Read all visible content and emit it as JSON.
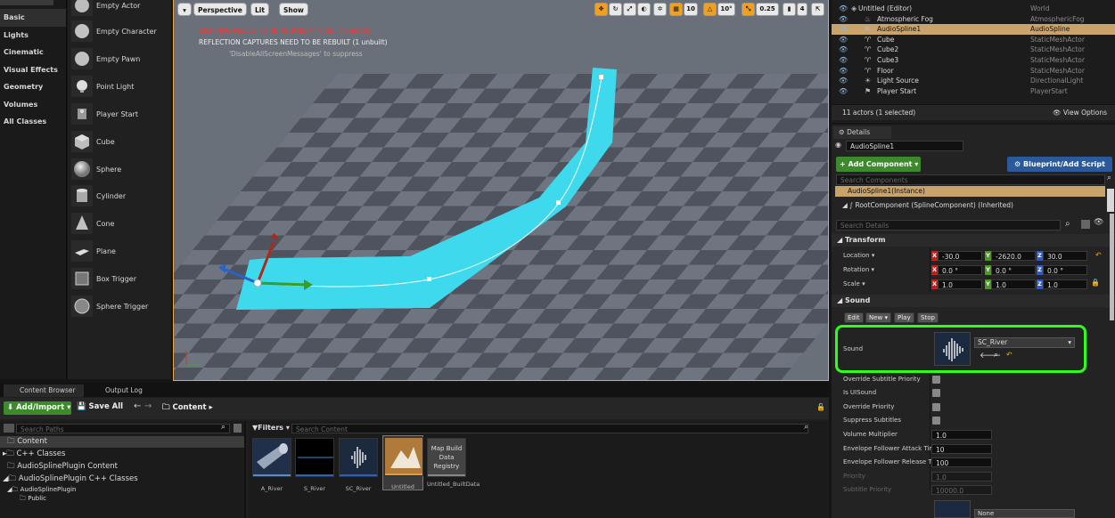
{
  "categories": [
    "Basic",
    "Lights",
    "Cinematic",
    "Visual Effects",
    "Geometry",
    "Volumes",
    "All Classes"
  ],
  "actors": [
    "Empty Actor",
    "Empty Character",
    "Empty Pawn",
    "Point Light",
    "Player Start",
    "Cube",
    "Sphere",
    "Cylinder",
    "Cone",
    "Plane",
    "Box Trigger",
    "Sphere Trigger"
  ],
  "viewport": {
    "perspective": "Perspective",
    "lit": "Lit",
    "show": "Show",
    "warning1": "LIGHTING NEEDS TO BE REBUILT (4 unbuilt objects)",
    "warning2": "REFLECTION CAPTURES NEED TO BE REBUILT (1 unbuilt)",
    "warning3": "'DisableAllScreenMessages' to suppress",
    "grid_snap": "10",
    "rot_snap": "10°",
    "scale_snap": "0.25",
    "cam_speed": "4"
  },
  "outliner": {
    "rows": [
      {
        "name": "Untitled (Editor)",
        "type": "World"
      },
      {
        "name": "Atmospheric Fog",
        "type": "AtmosphericFog"
      },
      {
        "name": "AudioSpline1",
        "type": "AudioSpline"
      },
      {
        "name": "Cube",
        "type": "StaticMeshActor"
      },
      {
        "name": "Cube2",
        "type": "StaticMeshActor"
      },
      {
        "name": "Cube3",
        "type": "StaticMeshActor"
      },
      {
        "name": "Floor",
        "type": "StaticMeshActor"
      },
      {
        "name": "Light Source",
        "type": "DirectionalLight"
      },
      {
        "name": "Player Start",
        "type": "PlayerStart"
      }
    ],
    "count": "11 actors (1 selected)",
    "view_options": "View Options"
  },
  "details": {
    "tab": "Details",
    "name": "AudioSpline1",
    "add_component": "+ Add Component",
    "blueprint_script": "Blueprint/Add Script",
    "search_components": "Search Components",
    "instance": "AudioSpline1(Instance)",
    "root_component": "RootComponent (SplineComponent) (Inherited)",
    "search_details": "Search Details",
    "transform_header": "Transform",
    "location_label": "Location",
    "rotation_label": "Rotation",
    "scale_label": "Scale",
    "location": [
      "-30.0",
      "-2620.0",
      "30.0"
    ],
    "rotation": [
      "0.0 °",
      "0.0 °",
      "0.0 °"
    ],
    "scale": [
      "1.0",
      "1.0",
      "1.0"
    ],
    "sound_header": "Sound",
    "edit": "Edit",
    "new": "New",
    "play": "Play",
    "stop": "Stop",
    "sound_label": "Sound",
    "sound_value": "SC_River",
    "override_subtitle": "Override Subtitle Priority",
    "is_ui_sound": "Is UISound",
    "override_priority": "Override Priority",
    "suppress_subtitles": "Suppress Subtitles",
    "volume_mult_label": "Volume Multiplier",
    "volume_mult": "1.0",
    "env_attack_label": "Envelope Follower Attack Tim",
    "env_attack": "10",
    "env_release_label": "Envelope Follower Release Ti",
    "env_release": "100",
    "priority_label": "Priority",
    "priority": "1.0",
    "subtitle_priority_label": "Subtitle Priority",
    "subtitle_priority": "10000.0",
    "none_value": "None"
  },
  "content_browser": {
    "tab1": "Content Browser",
    "tab2": "Output Log",
    "add_import": "Add/Import",
    "save_all": "Save All",
    "path": "Content",
    "search_paths": "Search Paths",
    "filters": "Filters",
    "search_content": "Search Content",
    "sources": [
      "Content",
      "C++ Classes",
      "AudioSplinePlugin Content",
      "AudioSplinePlugin C++ Classes",
      "AudioSplinePlugin",
      "Public"
    ],
    "assets": [
      "A_River",
      "S_River",
      "SC_River",
      "Untitled",
      "Untitled_BuiltData"
    ],
    "map_build_thumb": "Map Build Data Registry"
  },
  "colors": {
    "accent": "#e8a94a",
    "green_button": "#3c8a2c",
    "selection": "#c9a36a",
    "spline": "#3fd9ee",
    "highlight_box": "#2dff1a"
  }
}
